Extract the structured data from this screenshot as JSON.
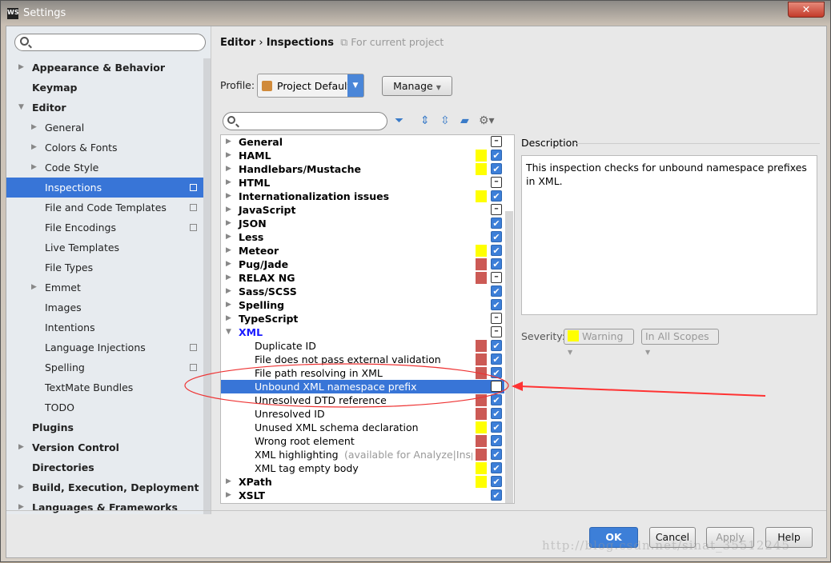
{
  "window": {
    "title": "Settings",
    "app_icon": "WS",
    "close": "✕"
  },
  "sidebar": {
    "search_placeholder": "",
    "items": [
      {
        "label": "Appearance & Behavior",
        "level": 0,
        "bold": true,
        "expander": "collapsed"
      },
      {
        "label": "Keymap",
        "level": 0,
        "bold": true
      },
      {
        "label": "Editor",
        "level": 0,
        "bold": true,
        "expander": "expanded"
      },
      {
        "label": "General",
        "level": 1,
        "expander": "collapsed"
      },
      {
        "label": "Colors & Fonts",
        "level": 1,
        "expander": "collapsed"
      },
      {
        "label": "Code Style",
        "level": 1,
        "expander": "collapsed"
      },
      {
        "label": "Inspections",
        "level": 1,
        "selected": true,
        "project": true
      },
      {
        "label": "File and Code Templates",
        "level": 1,
        "project": true
      },
      {
        "label": "File Encodings",
        "level": 1,
        "project": true
      },
      {
        "label": "Live Templates",
        "level": 1
      },
      {
        "label": "File Types",
        "level": 1
      },
      {
        "label": "Emmet",
        "level": 1,
        "expander": "collapsed"
      },
      {
        "label": "Images",
        "level": 1
      },
      {
        "label": "Intentions",
        "level": 1
      },
      {
        "label": "Language Injections",
        "level": 1,
        "project": true
      },
      {
        "label": "Spelling",
        "level": 1,
        "project": true
      },
      {
        "label": "TextMate Bundles",
        "level": 1
      },
      {
        "label": "TODO",
        "level": 1
      },
      {
        "label": "Plugins",
        "level": 0,
        "bold": true
      },
      {
        "label": "Version Control",
        "level": 0,
        "bold": true,
        "expander": "collapsed"
      },
      {
        "label": "Directories",
        "level": 0,
        "bold": true
      },
      {
        "label": "Build, Execution, Deployment",
        "level": 0,
        "bold": true,
        "expander": "collapsed"
      },
      {
        "label": "Languages & Frameworks",
        "level": 0,
        "bold": true,
        "expander": "collapsed"
      }
    ]
  },
  "breadcrumb": {
    "parent": "Editor",
    "sep": "›",
    "current": "Inspections",
    "scope": "For current project"
  },
  "profile": {
    "label": "Profile:",
    "value": "Project Default",
    "manage": "Manage"
  },
  "colors": {
    "warning": "#ffff00",
    "error": "#cc5a55",
    "accent": "#3875d7"
  },
  "tree": [
    {
      "name": "General",
      "group": true,
      "check": "mixed"
    },
    {
      "name": "HAML",
      "group": true,
      "sev": "warning",
      "check": "on"
    },
    {
      "name": "Handlebars/Mustache",
      "group": true,
      "sev": "warning",
      "check": "on"
    },
    {
      "name": "HTML",
      "group": true,
      "check": "mixed"
    },
    {
      "name": "Internationalization issues",
      "group": true,
      "sev": "warning",
      "check": "on"
    },
    {
      "name": "JavaScript",
      "group": true,
      "check": "mixed"
    },
    {
      "name": "JSON",
      "group": true,
      "check": "on"
    },
    {
      "name": "Less",
      "group": true,
      "check": "on"
    },
    {
      "name": "Meteor",
      "group": true,
      "sev": "warning",
      "check": "on"
    },
    {
      "name": "Pug/Jade",
      "group": true,
      "sev": "error",
      "check": "on"
    },
    {
      "name": "RELAX NG",
      "group": true,
      "sev": "error",
      "check": "mixed"
    },
    {
      "name": "Sass/SCSS",
      "group": true,
      "check": "on"
    },
    {
      "name": "Spelling",
      "group": true,
      "check": "on"
    },
    {
      "name": "TypeScript",
      "group": true,
      "check": "mixed"
    },
    {
      "name": "XML",
      "group": true,
      "expanded": true,
      "check": "mixed"
    },
    {
      "name": "Duplicate ID",
      "sev": "error",
      "check": "on"
    },
    {
      "name": "File does not pass external validation",
      "sev": "error",
      "check": "on"
    },
    {
      "name": "File path resolving in XML",
      "sev": "error",
      "check": "on"
    },
    {
      "name": "Unbound XML namespace prefix",
      "selected": true,
      "check": "off"
    },
    {
      "name": "Unresolved DTD reference",
      "sev": "error",
      "check": "on"
    },
    {
      "name": "Unresolved ID",
      "sev": "error",
      "check": "on"
    },
    {
      "name": "Unused XML schema declaration",
      "sev": "warning",
      "check": "on"
    },
    {
      "name": "Wrong root element",
      "sev": "error",
      "check": "on"
    },
    {
      "name": "XML highlighting",
      "extra": "(available for Analyze|Inspect",
      "sev": "error",
      "check": "on"
    },
    {
      "name": "XML tag empty body",
      "sev": "warning",
      "check": "on"
    },
    {
      "name": "XPath",
      "group": true,
      "sev": "warning",
      "check": "on"
    },
    {
      "name": "XSLT",
      "group": true,
      "check": "on"
    }
  ],
  "description": {
    "label": "Description",
    "text": "This inspection checks for unbound namespace prefixes in XML."
  },
  "severity": {
    "label": "Severity:",
    "value": "Warning",
    "scope": "In All Scopes"
  },
  "buttons": {
    "ok": "OK",
    "cancel": "Cancel",
    "apply": "Apply",
    "help": "Help"
  },
  "watermark": "http://blog.csdn.net/sinat_35512245"
}
